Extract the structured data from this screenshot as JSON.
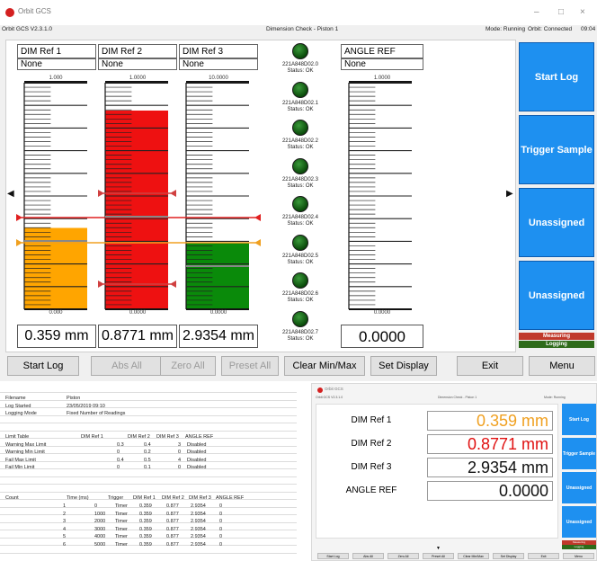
{
  "app": {
    "title": "Orbit GCS",
    "version": "Orbit GCS V2.3.1.0",
    "header_center": "Dimension Check - Piston 1",
    "mode": "Mode: Running",
    "orbit": "Orbit: Connected",
    "clock": "09:04"
  },
  "window_controls": {
    "minimize": "–",
    "maximize": "□",
    "close": "×"
  },
  "panels": [
    {
      "label": "DIM Ref 1",
      "sub": "None",
      "scale_top": "1.000",
      "scale_bottom": "0.000",
      "readout": "0.359 mm",
      "fill_color": "#ffa500",
      "fill_fraction": 0.359
    },
    {
      "label": "DIM Ref 2",
      "sub": "None",
      "scale_top": "1.0000",
      "scale_bottom": "0.0000",
      "readout": "0.8771 mm",
      "fill_color": "#ee1111",
      "fill_fraction": 0.8771
    },
    {
      "label": "DIM Ref 3",
      "sub": "None",
      "scale_top": "10.0000",
      "scale_bottom": "0.0000",
      "readout": "2.9354 mm",
      "fill_color": "#0a8a0a",
      "fill_fraction": 0.29354
    },
    {
      "label": "ANGLE REF",
      "sub": "None",
      "scale_top": "1.0000",
      "scale_bottom": "0.0000",
      "readout": "0.0000",
      "fill_color": "#ffffff",
      "fill_fraction": 0
    }
  ],
  "probes": [
    {
      "id": "221A848D02.0",
      "status": "Status: OK"
    },
    {
      "id": "221A848D02.1",
      "status": "Status: OK"
    },
    {
      "id": "221A848D02.2",
      "status": "Status: OK"
    },
    {
      "id": "221A848D02.3",
      "status": "Status: OK"
    },
    {
      "id": "221A848D02.4",
      "status": "Status: OK"
    },
    {
      "id": "221A848D02.5",
      "status": "Status: OK"
    },
    {
      "id": "221A848D02.6",
      "status": "Status: OK"
    },
    {
      "id": "221A848D02.7",
      "status": "Status: OK"
    }
  ],
  "side_buttons": [
    "Start Log",
    "Trigger Sample",
    "Unassigned",
    "Unassigned"
  ],
  "status_flags": {
    "measuring": "Measuring",
    "logging": "Logging",
    "measuring_color": "#c0392b",
    "logging_color": "#2e6b1a"
  },
  "bottom_buttons": {
    "start_log": "Start Log",
    "abs_all": "Abs All",
    "zero_all": "Zero All",
    "preset_all": "Preset All",
    "clear_minmax": "Clear Min/Max",
    "set_display": "Set Display",
    "exit": "Exit",
    "menu": "Menu"
  },
  "sheet": {
    "meta": [
      [
        "Filename",
        "Piston"
      ],
      [
        "Log Started",
        "23/05/2019 09:10"
      ],
      [
        "Logging Mode",
        "Fixed Number of Readings"
      ]
    ],
    "limit_header": [
      "Limit Table",
      "DIM Ref 1",
      "DIM Ref 2",
      "DIM Ref 3",
      "ANGLE REF"
    ],
    "limits": [
      [
        "Warning Max Limit",
        "0.3",
        "0.4",
        "3",
        "Disabled"
      ],
      [
        "Warning Min Limit",
        "0",
        "0.2",
        "0",
        "Disabled"
      ],
      [
        "Fail Max Limit",
        "0.4",
        "0.5",
        "4",
        "Disabled"
      ],
      [
        "Fail Min Limit",
        "0",
        "0.1",
        "0",
        "Disabled"
      ]
    ],
    "log_header": [
      "Count",
      "Time (ms)",
      "Trigger",
      "DIM Ref 1",
      "DIM Ref 2",
      "DIM Ref 3",
      "ANGLE REF"
    ],
    "log_rows": [
      [
        "1",
        "0",
        "Timer",
        "0.359",
        "0.877",
        "2.9354",
        "0"
      ],
      [
        "2",
        "1000",
        "Timer",
        "0.359",
        "0.877",
        "2.9354",
        "0"
      ],
      [
        "3",
        "2000",
        "Timer",
        "0.359",
        "0.877",
        "2.9354",
        "0"
      ],
      [
        "4",
        "3000",
        "Timer",
        "0.359",
        "0.877",
        "2.9354",
        "0"
      ],
      [
        "5",
        "4000",
        "Timer",
        "0.359",
        "0.877",
        "2.9354",
        "0"
      ],
      [
        "6",
        "5000",
        "Timer",
        "0.359",
        "0.877",
        "2.9354",
        "0"
      ]
    ]
  },
  "mini": {
    "rows": [
      {
        "label": "DIM Ref 1",
        "value": "0.359 mm",
        "color": "#f0a020"
      },
      {
        "label": "DIM Ref 2",
        "value": "0.8771 mm",
        "color": "#e01010"
      },
      {
        "label": "DIM Ref 3",
        "value": "2.9354 mm",
        "color": "#111111"
      },
      {
        "label": "ANGLE REF",
        "value": "0.0000",
        "color": "#111111"
      }
    ],
    "side_buttons": [
      "Start Log",
      "Trigger Sample",
      "Unassigned",
      "Unassigned"
    ],
    "bottom_buttons": [
      "Start Log",
      "Abs All",
      "Zero All",
      "Preset All",
      "Clear Min/Max",
      "Set Display",
      "Exit",
      "Menu"
    ],
    "flags": [
      "Measuring",
      "Logging"
    ]
  }
}
